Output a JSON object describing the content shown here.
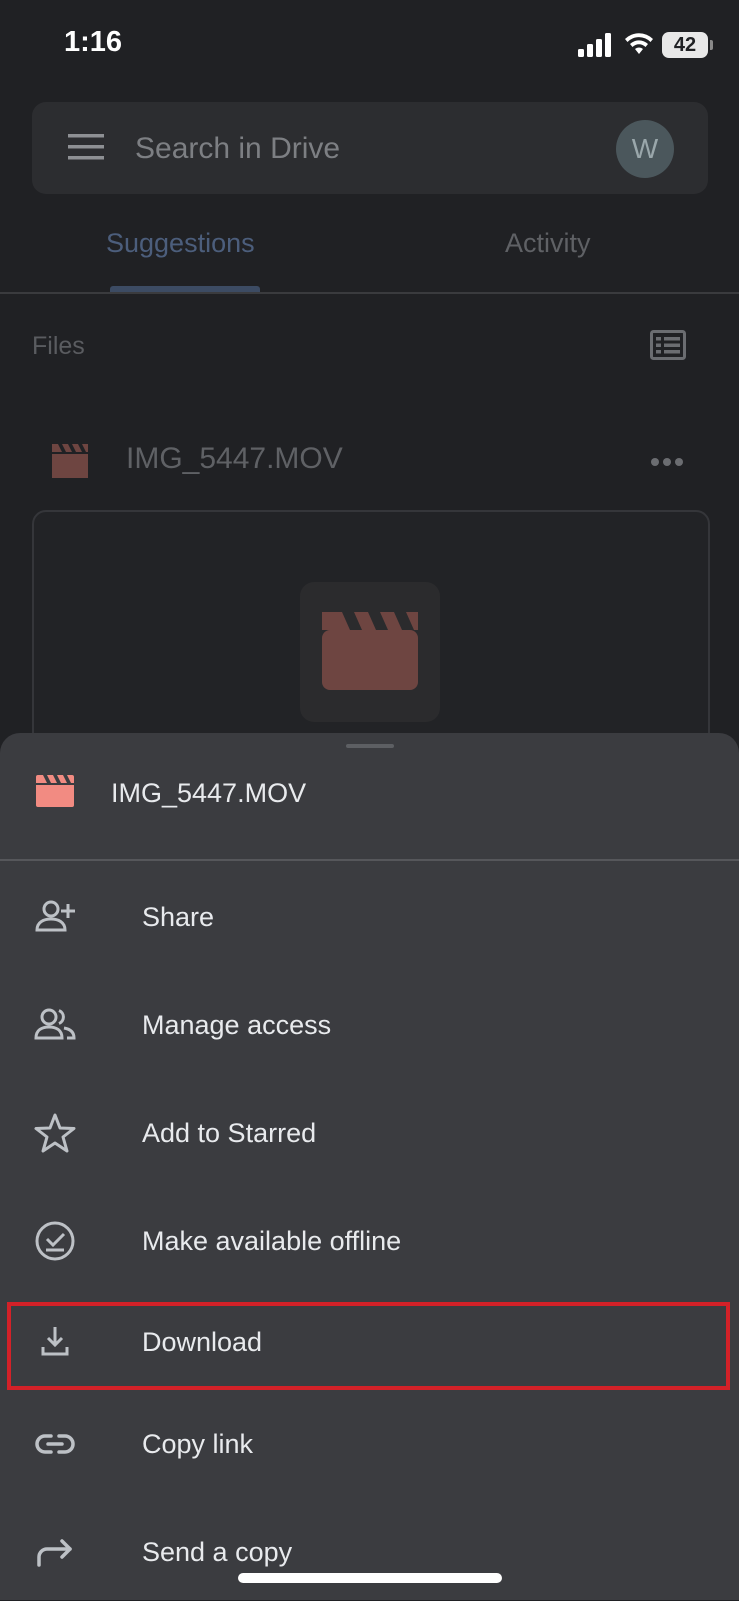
{
  "status_bar": {
    "time": "1:16",
    "battery": "42"
  },
  "search": {
    "placeholder": "Search in Drive",
    "avatar_initial": "W"
  },
  "tabs": [
    {
      "label": "Suggestions",
      "active": true
    },
    {
      "label": "Activity",
      "active": false
    }
  ],
  "files_section": {
    "label": "Files"
  },
  "file": {
    "name": "IMG_5447.MOV",
    "icon": "video-clapper-icon",
    "color": "#f28b82"
  },
  "sheet": {
    "file_name": "IMG_5447.MOV",
    "items": [
      {
        "label": "Share",
        "icon": "person-add-icon"
      },
      {
        "label": "Manage access",
        "icon": "people-icon"
      },
      {
        "label": "Add to Starred",
        "icon": "star-icon"
      },
      {
        "label": "Make available offline",
        "icon": "offline-icon"
      },
      {
        "label": "Download",
        "icon": "download-icon",
        "highlighted": true
      },
      {
        "label": "Copy link",
        "icon": "link-icon"
      },
      {
        "label": "Send a copy",
        "icon": "send-copy-icon"
      }
    ]
  },
  "colors": {
    "highlight": "#d32128",
    "sheet_bg": "#3b3c40",
    "page_bg": "#202124"
  }
}
